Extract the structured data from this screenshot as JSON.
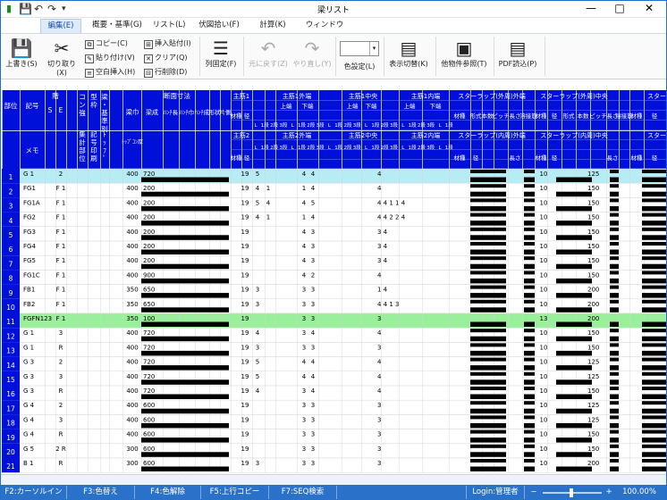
{
  "window": {
    "title": "梁リスト",
    "minimize": "—",
    "maximize": "□",
    "close": "✕"
  },
  "menu": {
    "tabs": [
      {
        "label": "編集(E)",
        "active": true
      },
      {
        "label": "概要・基準(G)",
        "active": false
      },
      {
        "label": "リスト(L)",
        "active": false
      },
      {
        "label": "伏図拾い(F)",
        "active": false
      },
      {
        "label": "計算(K)",
        "active": false
      },
      {
        "label": "ウィンドウ(W)",
        "active": false
      }
    ]
  },
  "ribbon": {
    "save": "上書き(S)",
    "cut": "切り取り(X)",
    "copy": "コピー(C)",
    "paste": "貼り付け(V)",
    "insert_blank": "空白挿入(H)",
    "insert_paste": "挿入貼付(I)",
    "clear": "クリア(Q)",
    "delete_row": "行削除(D)",
    "fix_column": "列固定(F)",
    "undo": "元に戻す(Z)",
    "redo": "やり直し(Y)",
    "color_setting": "色設定(L)",
    "display_switch": "表示切替(K)",
    "other_ref": "他物件参照(T)",
    "pdf_read": "PDF読込(P)"
  },
  "grid": {
    "headers": {
      "bui": "部位",
      "kigou": "記号",
      "s": "S",
      "e": "E",
      "kai": "階",
      "kon_kyou": "コン強",
      "waku": "型枠",
      "hari_ki": "梁・基準別",
      "dansun": "断面寸法",
      "harihaba": "梁巾",
      "haridaka": "梁成",
      "haunchi_naga": "ﾊﾝﾁ長",
      "haunchi_haba": "ﾊﾝﾁ巾",
      "haunchi_sei": "ﾊﾝﾁ成",
      "keijo": "形状",
      "kata": "片側",
      "shukin1": "主筋1",
      "shukin1_hashi": "主筋1外端",
      "shukin1_naka": "主筋1中央",
      "shukin1_uchi": "主筋1内端",
      "stirrup_soto": "スターラップ(外周)外端",
      "stirrup_naka": "スターラップ(外周)中央",
      "stirrup_next": "スターラ",
      "zai": "材種",
      "kei": "径",
      "ue": "上端",
      "shita": "下端",
      "kei2": "形式",
      "honsu": "本数",
      "pitch": "ピッチ",
      "naga": "長さ",
      "yousetsu": "溶接筋",
      "memo": "メモ",
      "shukei": "集計部位",
      "kigou_in": "記号印刷",
      "topcon": "ﾄｯﾌﾟｺﾝ厚",
      "shukin2": "主筋2",
      "shukin2_hashi": "主筋2外端",
      "shukin2_naka": "主筋2中央",
      "shukin2_uchi": "主筋2内端",
      "stirrup_in_soto": "スターラップ(内周)外端",
      "stirrup_in_naka": "スターラップ(内周)中央",
      "stirrup_in_next": "スターラ",
      "sub1": "1段",
      "sub2": "2段",
      "sub3": "3段",
      "top": "ﾄｯﾌﾟ",
      "l": "L",
      "r": "R",
      "mid": "M"
    },
    "rows": [
      {
        "no": "1",
        "kigou": "G 1",
        "e": "2",
        "b": "400",
        "d": "720",
        "z": "19",
        "k": "5",
        "a": "",
        "b2": "",
        "c": "4",
        "d2": "4",
        "u": "4",
        "st": "125",
        "hl": "sel"
      },
      {
        "no": "2",
        "kigou": "FG1",
        "e": "F 1",
        "b": "400",
        "d": "200",
        "z": "19",
        "k": "4",
        "a": "1",
        "b2": "",
        "c": "1",
        "d2": "4",
        "u": "4",
        "st": "150",
        "hl": ""
      },
      {
        "no": "3",
        "kigou": "FG1A",
        "e": "F 1",
        "b": "400",
        "d": "200",
        "z": "19",
        "k": "5",
        "a": "4",
        "b2": "",
        "c": "4",
        "d2": "5",
        "u": "4 4 1     1 4",
        "st": "150",
        "hl": ""
      },
      {
        "no": "4",
        "kigou": "FG2",
        "e": "F 1",
        "b": "400",
        "d": "200",
        "z": "19",
        "k": "4",
        "a": "1",
        "b2": "",
        "c": "1",
        "d2": "4",
        "u": "4 4 2     2 4",
        "st": "150",
        "hl": ""
      },
      {
        "no": "5",
        "kigou": "FG3",
        "e": "F 1",
        "b": "400",
        "d": "200",
        "z": "19",
        "k": "",
        "a": "",
        "b2": "",
        "c": "4",
        "d2": "3",
        "u": "3 4",
        "st": "150",
        "hl": ""
      },
      {
        "no": "6",
        "kigou": "FG4",
        "e": "F 1",
        "b": "400",
        "d": "200",
        "z": "19",
        "k": "",
        "a": "",
        "b2": "",
        "c": "4",
        "d2": "3",
        "u": "3 4",
        "st": "150",
        "hl": ""
      },
      {
        "no": "7",
        "kigou": "FG5",
        "e": "F 1",
        "b": "400",
        "d": "200",
        "z": "19",
        "k": "",
        "a": "",
        "b2": "",
        "c": "4",
        "d2": "3",
        "u": "3 4",
        "st": "150",
        "hl": ""
      },
      {
        "no": "8",
        "kigou": "FG1C",
        "e": "F 1",
        "b": "400",
        "d": "900",
        "z": "19",
        "k": "",
        "a": "",
        "b2": "",
        "c": "4",
        "d2": "2",
        "u": "4",
        "st": "150",
        "hl": ""
      },
      {
        "no": "9",
        "kigou": "FB1",
        "e": "F 1",
        "b": "350",
        "d": "650",
        "z": "19",
        "k": "3",
        "a": "",
        "b2": "",
        "c": "3",
        "d2": "3",
        "u": "1 4",
        "st": "200",
        "hl": ""
      },
      {
        "no": "10",
        "kigou": "FB2",
        "e": "F 1",
        "b": "350",
        "d": "650",
        "z": "19",
        "k": "3",
        "a": "",
        "b2": "",
        "c": "3",
        "d2": "3",
        "u": "4 4 1     3",
        "st": "200",
        "hl": ""
      },
      {
        "no": "11",
        "kigou": "FGFN123",
        "e": "F 1",
        "b": "350",
        "d": "100",
        "z": "19",
        "k": "",
        "a": "",
        "b2": "",
        "c": "3",
        "d2": "3",
        "u": "3",
        "st": "200",
        "hl": "green"
      },
      {
        "no": "12",
        "kigou": "G 1",
        "e": "3",
        "b": "400",
        "d": "720",
        "z": "19",
        "k": "4",
        "a": "",
        "b2": "",
        "c": "3",
        "d2": "4",
        "u": "4",
        "st": "150",
        "hl": ""
      },
      {
        "no": "13",
        "kigou": "G 1",
        "e": "R",
        "b": "400",
        "d": "720",
        "z": "19",
        "k": "3",
        "a": "",
        "b2": "",
        "c": "3",
        "d2": "3",
        "u": "3",
        "st": "150",
        "hl": ""
      },
      {
        "no": "14",
        "kigou": "G 3",
        "e": "2",
        "b": "400",
        "d": "720",
        "z": "19",
        "k": "5",
        "a": "",
        "b2": "",
        "c": "4",
        "d2": "4",
        "u": "4",
        "st": "125",
        "hl": ""
      },
      {
        "no": "15",
        "kigou": "G 3",
        "e": "3",
        "b": "400",
        "d": "720",
        "z": "19",
        "k": "5",
        "a": "",
        "b2": "",
        "c": "4",
        "d2": "4",
        "u": "4",
        "st": "125",
        "hl": ""
      },
      {
        "no": "16",
        "kigou": "G 3",
        "e": "R",
        "b": "400",
        "d": "720",
        "z": "19",
        "k": "4",
        "a": "",
        "b2": "",
        "c": "3",
        "d2": "4",
        "u": "4",
        "st": "150",
        "hl": ""
      },
      {
        "no": "17",
        "kigou": "G 4",
        "e": "2",
        "b": "400",
        "d": "600",
        "z": "19",
        "k": "",
        "a": "",
        "b2": "",
        "c": "3",
        "d2": "3",
        "u": "3",
        "st": "125",
        "hl": ""
      },
      {
        "no": "18",
        "kigou": "G 4",
        "e": "3",
        "b": "400",
        "d": "600",
        "z": "19",
        "k": "",
        "a": "",
        "b2": "",
        "c": "3",
        "d2": "3",
        "u": "3",
        "st": "125",
        "hl": ""
      },
      {
        "no": "19",
        "kigou": "G 4",
        "e": "R",
        "b": "400",
        "d": "600",
        "z": "19",
        "k": "",
        "a": "",
        "b2": "",
        "c": "3",
        "d2": "3",
        "u": "3",
        "st": "150",
        "hl": ""
      },
      {
        "no": "20",
        "kigou": "G 5",
        "e": "2 R",
        "b": "300",
        "d": "600",
        "z": "19",
        "k": "",
        "a": "",
        "b2": "",
        "c": "3",
        "d2": "3",
        "u": "3",
        "st": "150",
        "hl": ""
      },
      {
        "no": "21",
        "kigou": "B 1",
        "e": "R",
        "b": "300",
        "d": "600",
        "z": "19",
        "k": "3",
        "a": "",
        "b2": "",
        "c": "3",
        "d2": "3",
        "u": "3",
        "st": "200",
        "hl": ""
      }
    ],
    "stirrup_zai": "10",
    "stirrup_zai_green": "13"
  },
  "bottom_tabs": [
    "F2:カーソルイン",
    "F3:色替え",
    "F4:色解除",
    "F5:上行コピー",
    "F7:SEQ検索"
  ],
  "status": {
    "login": "Login:管理者",
    "zoom": "100.00%",
    "zoom_minus": "−",
    "zoom_plus": "+"
  },
  "colors": {
    "header_blue": "#0010d8",
    "selected_row": "#b8ecf4",
    "green_row": "#9af09a",
    "status_blue": "#2a72c9",
    "black_bar": "#000000"
  }
}
